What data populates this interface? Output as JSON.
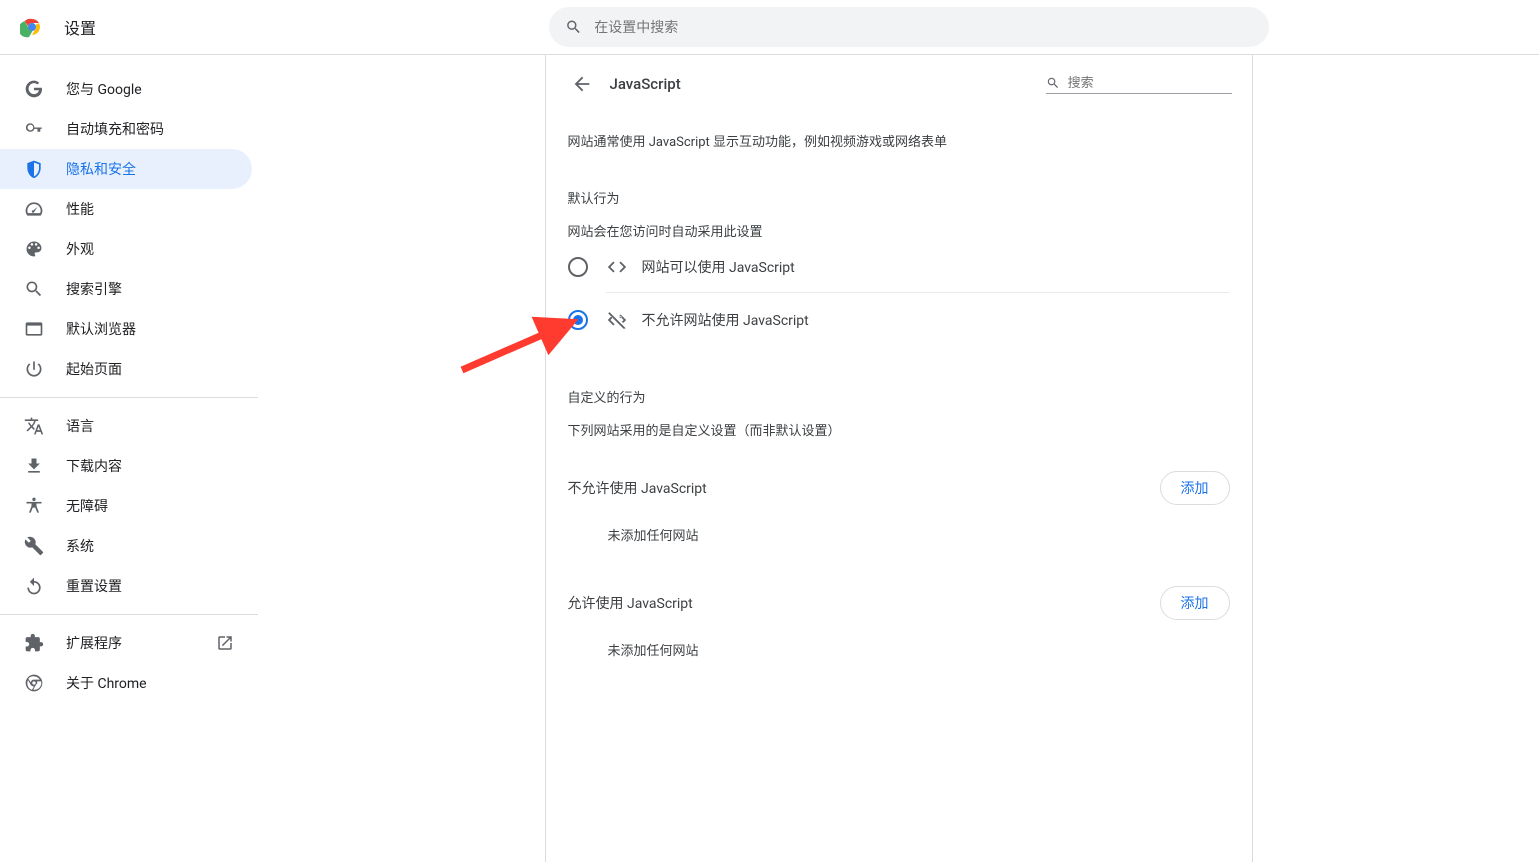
{
  "header": {
    "title": "设置",
    "search_placeholder": "在设置中搜索"
  },
  "sidebar": {
    "items_a": [
      {
        "label": "您与 Google"
      },
      {
        "label": "自动填充和密码"
      },
      {
        "label": "隐私和安全"
      },
      {
        "label": "性能"
      },
      {
        "label": "外观"
      },
      {
        "label": "搜索引擎"
      },
      {
        "label": "默认浏览器"
      },
      {
        "label": "起始页面"
      }
    ],
    "items_b": [
      {
        "label": "语言"
      },
      {
        "label": "下载内容"
      },
      {
        "label": "无障碍"
      },
      {
        "label": "系统"
      },
      {
        "label": "重置设置"
      }
    ],
    "items_c": [
      {
        "label": "扩展程序"
      },
      {
        "label": "关于 Chrome"
      }
    ]
  },
  "content": {
    "title": "JavaScript",
    "search_placeholder": "搜索",
    "intro": "网站通常使用 JavaScript 显示互动功能，例如视频游戏或网络表单",
    "default_label": "默认行为",
    "default_desc": "网站会在您访问时自动采用此设置",
    "opt_allow": "网站可以使用 JavaScript",
    "opt_block": "不允许网站使用 JavaScript",
    "custom_label": "自定义的行为",
    "custom_desc": "下列网站采用的是自定义设置（而非默认设置）",
    "block_header": "不允许使用 JavaScript",
    "allow_header": "允许使用 JavaScript",
    "add_btn": "添加",
    "empty": "未添加任何网站"
  }
}
